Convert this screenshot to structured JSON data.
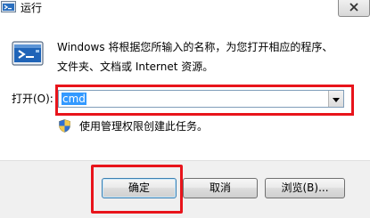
{
  "window": {
    "title": "运行",
    "close_symbol": "✕"
  },
  "description": {
    "line1": "Windows 将根据您所输入的名称，为您打开相应的程序、",
    "line2": "文件夹、文档或 Internet 资源。"
  },
  "open_field": {
    "label": "打开(O):",
    "value": "cmd"
  },
  "admin_note": "使用管理权限创建此任务。",
  "buttons": {
    "ok": "确定",
    "cancel": "取消",
    "browse": "浏览(B)..."
  },
  "icons": {
    "title": "run-icon",
    "main": "run-dialog-icon",
    "shield": "uac-shield-icon",
    "dropdown": "chevron-down-icon",
    "close": "close-icon"
  },
  "colors": {
    "highlight": "#e8141b",
    "selection": "#3399ff"
  }
}
